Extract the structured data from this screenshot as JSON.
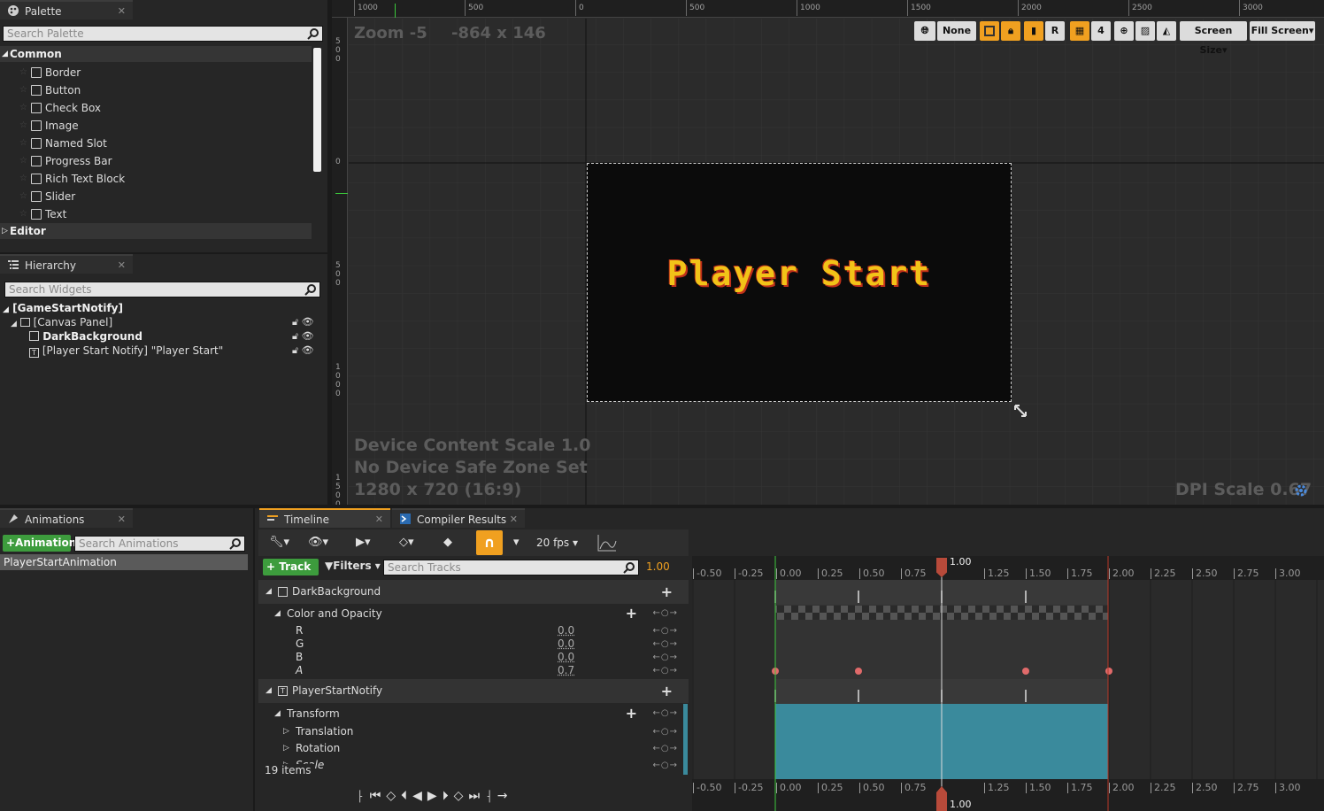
{
  "palette": {
    "tab_label": "Palette",
    "search_placeholder": "Search Palette",
    "category_common": "Common",
    "items": [
      {
        "label": "Border",
        "icon": "border-icon"
      },
      {
        "label": "Button",
        "icon": "button-icon"
      },
      {
        "label": "Check Box",
        "icon": "checkbox-icon"
      },
      {
        "label": "Image",
        "icon": "image-icon"
      },
      {
        "label": "Named Slot",
        "icon": "named-slot-icon"
      },
      {
        "label": "Progress Bar",
        "icon": "progress-bar-icon"
      },
      {
        "label": "Rich Text Block",
        "icon": "rich-text-icon"
      },
      {
        "label": "Slider",
        "icon": "slider-icon"
      },
      {
        "label": "Text",
        "icon": "text-icon"
      }
    ],
    "category_editor": "Editor"
  },
  "hierarchy": {
    "tab_label": "Hierarchy",
    "search_placeholder": "Search Widgets",
    "root": "[GameStartNotify]",
    "canvas": "[Canvas Panel]",
    "child1": "DarkBackground",
    "child2": "[Player Start Notify] \"Player Start\""
  },
  "designer": {
    "zoom": "Zoom -5",
    "coords": "-864 x 146",
    "ruler_h": [
      "1000",
      "500",
      "0",
      "500",
      "1000",
      "1500",
      "2000",
      "2500",
      "3000"
    ],
    "ruler_v": [
      "500",
      "0",
      "500",
      "1000",
      "1500"
    ],
    "preview_text": "Player Start",
    "device_scale": "Device Content Scale 1.0",
    "safe_zone": "No Device Safe Zone Set",
    "resolution": "1280 x 720 (16:9)",
    "dpi": "DPI Scale 0.67",
    "toolbar": {
      "none_label": "None",
      "r_label": "R",
      "grid_num": "4",
      "screen_size": "Screen Size",
      "fill_screen": "Fill Screen"
    }
  },
  "animations": {
    "tab_label": "Animations",
    "add_button": "+Animation",
    "search_placeholder": "Search Animations",
    "list": [
      "PlayerStartAnimation"
    ]
  },
  "timeline": {
    "tab_label": "Timeline",
    "compiler_tab": "Compiler Results",
    "fps": "20 fps",
    "track_button": "Track",
    "filters_button": "Filters",
    "search_tracks_placeholder": "Search Tracks",
    "current_time": "1.00",
    "ticks": [
      "-0.50",
      "-0.25",
      "0.00",
      "0.25",
      "0.50",
      "0.75",
      "1.25",
      "1.50",
      "1.75",
      "2.00",
      "2.25",
      "2.50",
      "2.75",
      "3.00"
    ],
    "playhead_label": "1.00",
    "tracks": {
      "dark_background": "DarkBackground",
      "color_opacity": "Color and Opacity",
      "r": "R",
      "g": "G",
      "b": "B",
      "a": "A",
      "r_val": "0.0",
      "g_val": "0.0",
      "b_val": "0.0",
      "a_val": "0.7",
      "player_start_notify": "PlayerStartNotify",
      "transform": "Transform",
      "translation": "Translation",
      "rotation": "Rotation",
      "scale": "Scale"
    },
    "item_count": "19 items"
  },
  "colors": {
    "accent_orange": "#f0a020",
    "green": "#3d9c3d",
    "teal": "#3a8a9c",
    "playhead": "#b84a3a"
  }
}
